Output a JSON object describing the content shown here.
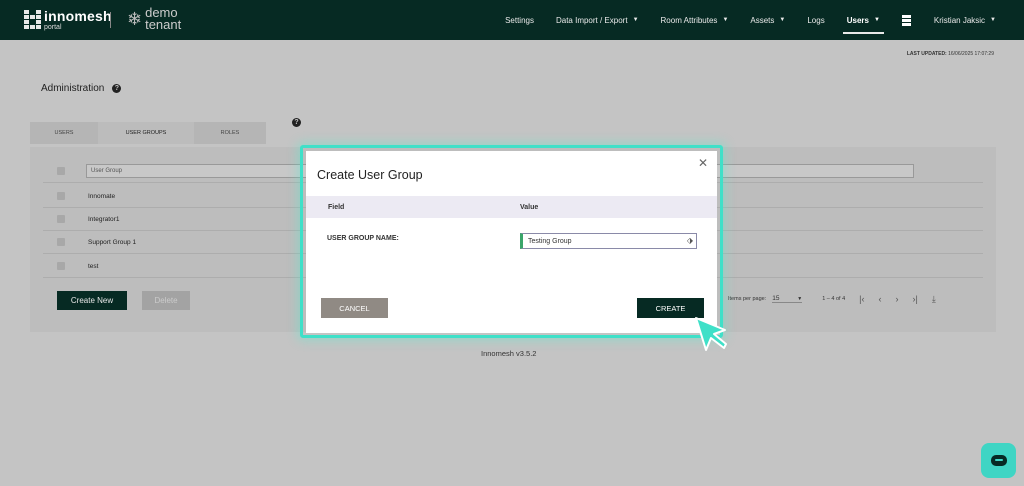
{
  "navbar": {
    "logo": {
      "name": "innomesh",
      "sub": "portal"
    },
    "tenant": {
      "line1": "demo",
      "line2": "tenant"
    },
    "items": [
      {
        "label": "Settings",
        "dropdown": false
      },
      {
        "label": "Data Import / Export",
        "dropdown": true
      },
      {
        "label": "Room Attributes",
        "dropdown": true
      },
      {
        "label": "Assets",
        "dropdown": true
      },
      {
        "label": "Logs",
        "dropdown": false
      },
      {
        "label": "Users",
        "dropdown": true,
        "active": true
      }
    ],
    "apps_icon": "grid-icon",
    "user": "Kristian Jaksic"
  },
  "last_updated": {
    "label": "LAST UPDATED:",
    "value": "16/06/2025 17:07:29"
  },
  "page": {
    "title": "Administration",
    "tabs": [
      "USERS",
      "USER GROUPS",
      "ROLES"
    ],
    "active_tab": "USER GROUPS"
  },
  "table": {
    "filter_placeholder": "User Group",
    "rows": [
      "Innomate",
      "Integrator1",
      "Support Group 1",
      "test"
    ]
  },
  "actions": {
    "create_new": "Create New",
    "delete": "Delete"
  },
  "paginator": {
    "items_per_page_label": "Items per page:",
    "items_per_page": "15",
    "range": "1 – 4 of 4"
  },
  "version": "Innomesh v3.5.2",
  "modal": {
    "title": "Create User Group",
    "col_field": "Field",
    "col_value": "Value",
    "field_label": "USER GROUP NAME:",
    "field_value": "Testing Group",
    "cancel": "CANCEL",
    "create": "CREATE"
  },
  "colors": {
    "brand": "#062a23",
    "highlight": "#3fe0c8"
  }
}
